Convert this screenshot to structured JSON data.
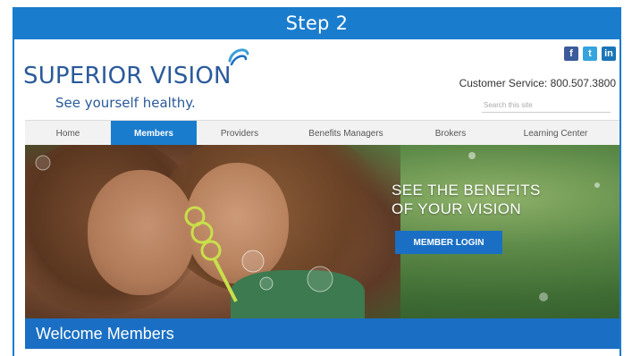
{
  "step": {
    "label": "Step 2"
  },
  "header": {
    "logo_text": "SUPERIOR VISION",
    "tagline": "See yourself healthy.",
    "customer_service": "Customer Service: 800.507.3800",
    "search_placeholder": "Search this site",
    "social": [
      "f",
      "t",
      "in"
    ]
  },
  "nav": {
    "items": [
      {
        "label": "Home"
      },
      {
        "label": "Members"
      },
      {
        "label": "Providers"
      },
      {
        "label": "Benefits Managers"
      },
      {
        "label": "Brokers"
      },
      {
        "label": "Learning Center"
      }
    ],
    "active_index": 1
  },
  "hero": {
    "title_line1": "SEE THE BENEFITS",
    "title_line2": "OF YOUR VISION",
    "login_button": "MEMBER LOGIN"
  },
  "welcome": {
    "title": "Welcome Members"
  },
  "colors": {
    "brand_blue": "#1a7ccd",
    "logo_blue": "#2a5a9a"
  }
}
